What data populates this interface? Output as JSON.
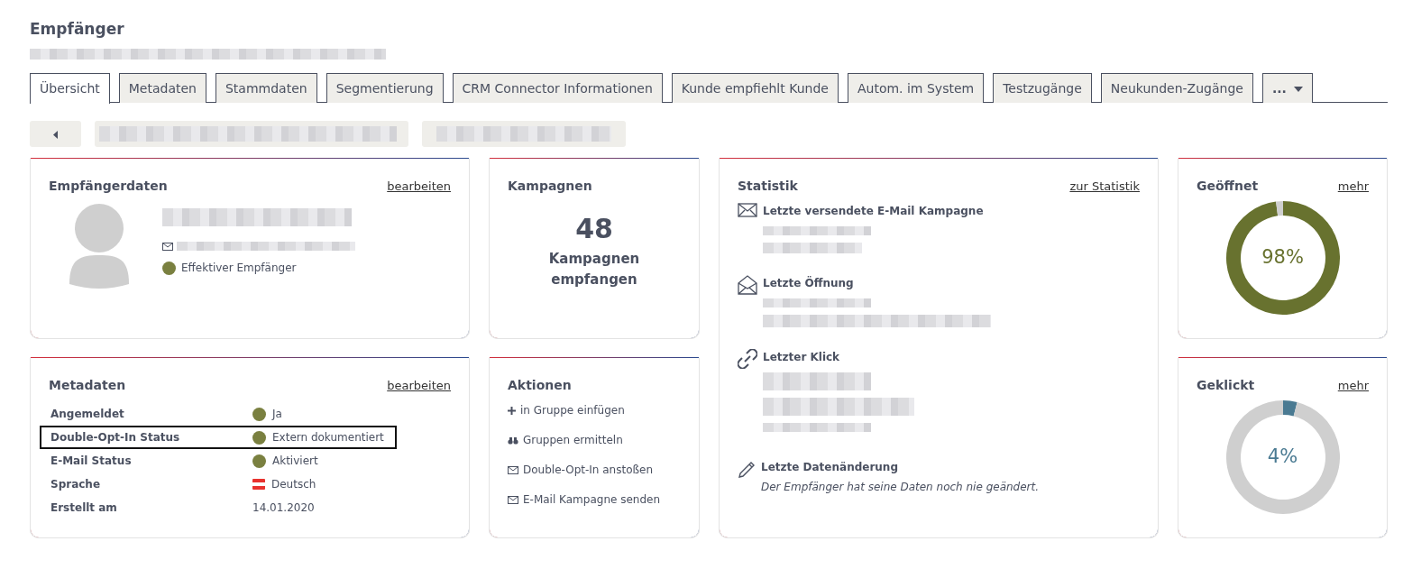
{
  "page": {
    "title": "Empfänger"
  },
  "tabs": [
    {
      "label": "Übersicht",
      "selected": true
    },
    {
      "label": "Metadaten",
      "selected": false
    },
    {
      "label": "Stammdaten",
      "selected": false
    },
    {
      "label": "Segmentierung",
      "selected": false
    },
    {
      "label": "CRM Connector Informationen",
      "selected": false
    },
    {
      "label": "Kunde empfiehlt Kunde",
      "selected": false
    },
    {
      "label": "Autom. im System",
      "selected": false
    },
    {
      "label": "Testzugänge",
      "selected": false
    },
    {
      "label": "Neukunden-Zugänge",
      "selected": false
    },
    {
      "label": "...",
      "selected": false,
      "kind": "more"
    }
  ],
  "recipient": {
    "title": "Empfängerdaten",
    "edit_link": "bearbeiten",
    "status": {
      "text": "Effektiver Empfänger",
      "color": "#7a8040"
    }
  },
  "campaigns": {
    "title": "Kampagnen",
    "count": "48",
    "caption": "Kampagnen empfangen"
  },
  "statistics": {
    "title": "Statistik",
    "link": "zur Statistik",
    "items": [
      {
        "kind": "mail",
        "label": "Letzte versendete E-Mail Kampagne"
      },
      {
        "kind": "open",
        "label": "Letzte Öffnung"
      },
      {
        "kind": "link",
        "label": "Letzter Klick"
      },
      {
        "kind": "edit",
        "label": "Letzte Datenänderung",
        "note": "Der Empfänger hat seine Daten noch nie geändert."
      }
    ]
  },
  "opened": {
    "title": "Geöffnet",
    "link": "mehr",
    "reading": "98%",
    "color": "#68722f",
    "chart_data": {
      "type": "donut",
      "values": [
        98,
        2
      ]
    }
  },
  "metadata": {
    "title": "Metadaten",
    "edit_link": "bearbeiten",
    "rows": [
      {
        "label": "Angemeldet",
        "value": "Ja",
        "kind": "dot",
        "color": "#7a8040",
        "highlighted": false
      },
      {
        "label": "Double-Opt-In Status",
        "value": "Extern dokumentiert",
        "kind": "dot",
        "color": "#7a8040",
        "highlighted": true
      },
      {
        "label": "E-Mail Status",
        "value": "Aktiviert",
        "kind": "dot",
        "color": "#7a8040",
        "highlighted": false
      },
      {
        "label": "Sprache",
        "value": "Deutsch",
        "kind": "flag",
        "highlighted": false
      },
      {
        "label": "Erstellt am",
        "value": "14.01.2020",
        "kind": "text",
        "highlighted": false
      }
    ]
  },
  "actions": {
    "title": "Aktionen",
    "items": [
      {
        "kind": "plus",
        "label": "in Gruppe einfügen"
      },
      {
        "kind": "binoculars",
        "label": "Gruppen ermitteln"
      },
      {
        "kind": "mail",
        "label": "Double-Opt-In anstoßen"
      },
      {
        "kind": "mail",
        "label": "E-Mail Kampagne senden"
      }
    ]
  },
  "clicked": {
    "title": "Geklickt",
    "link": "mehr",
    "reading": "4%",
    "color": "#4a7a92",
    "chart_data": {
      "type": "donut",
      "values": [
        4,
        96
      ]
    }
  }
}
